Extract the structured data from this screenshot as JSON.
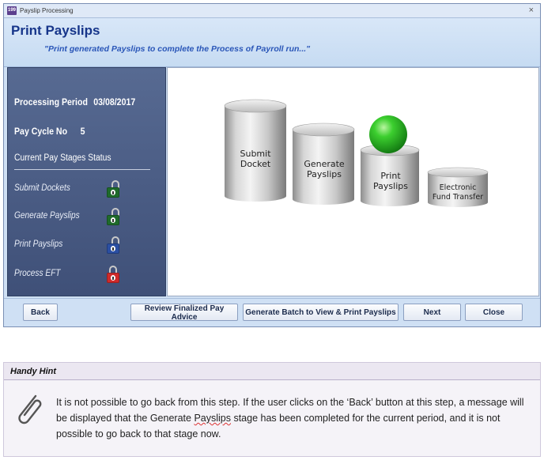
{
  "window": {
    "title": "Payslip Processing",
    "app_icon_text": "199",
    "close_glyph": "×"
  },
  "header": {
    "title": "Print Payslips",
    "subtitle": "\"Print generated Payslips to complete the Process of Payroll run...\""
  },
  "info": {
    "processing_period_label": "Processing Period",
    "processing_period_value": "03/08/2017",
    "pay_cycle_label": "Pay Cycle No",
    "pay_cycle_value": "5",
    "stages_heading": "Current Pay Stages Status"
  },
  "stages": [
    {
      "label": "Submit Dockets",
      "lock_color": "#1f6b2b",
      "lock_icon": "padlock-unlocked-green"
    },
    {
      "label": "Generate Payslips",
      "lock_color": "#1f6b2b",
      "lock_icon": "padlock-unlocked-green"
    },
    {
      "label": "Print Payslips",
      "lock_color": "#2b4fa3",
      "lock_icon": "padlock-unlocked-blue"
    },
    {
      "label": "Process EFT",
      "lock_color": "#cf2a2a",
      "lock_icon": "padlock-locked-red"
    }
  ],
  "process_diagram": {
    "steps": [
      {
        "line1": "Submit",
        "line2": "Docket"
      },
      {
        "line1": "Generate",
        "line2": "Payslips"
      },
      {
        "line1": "Print",
        "line2": "Payslips"
      },
      {
        "line1": "Electronic",
        "line2": "Fund Transfer"
      }
    ],
    "current_step_marker": "green-ball"
  },
  "buttons": {
    "back": "Back",
    "review": "Review Finalized Pay Advice",
    "generate": "Generate Batch to View & Print Payslips",
    "next": "Next",
    "close": "Close"
  },
  "hint": {
    "heading": "Handy Hint",
    "text_before": "It is not possible to go back from this step. If the user clicks on the ‘Back’ button at this step, a message will be displayed that the Generate ",
    "text_underlined": "Payslips",
    "text_after": " stage has been completed for the current period, and it is not possible to go back to that stage now."
  },
  "colors": {
    "title_blue": "#16358a",
    "subtitle_blue": "#2a56b8",
    "panel_navy": "#4a5c85",
    "green_ball": "#2fb52a"
  }
}
